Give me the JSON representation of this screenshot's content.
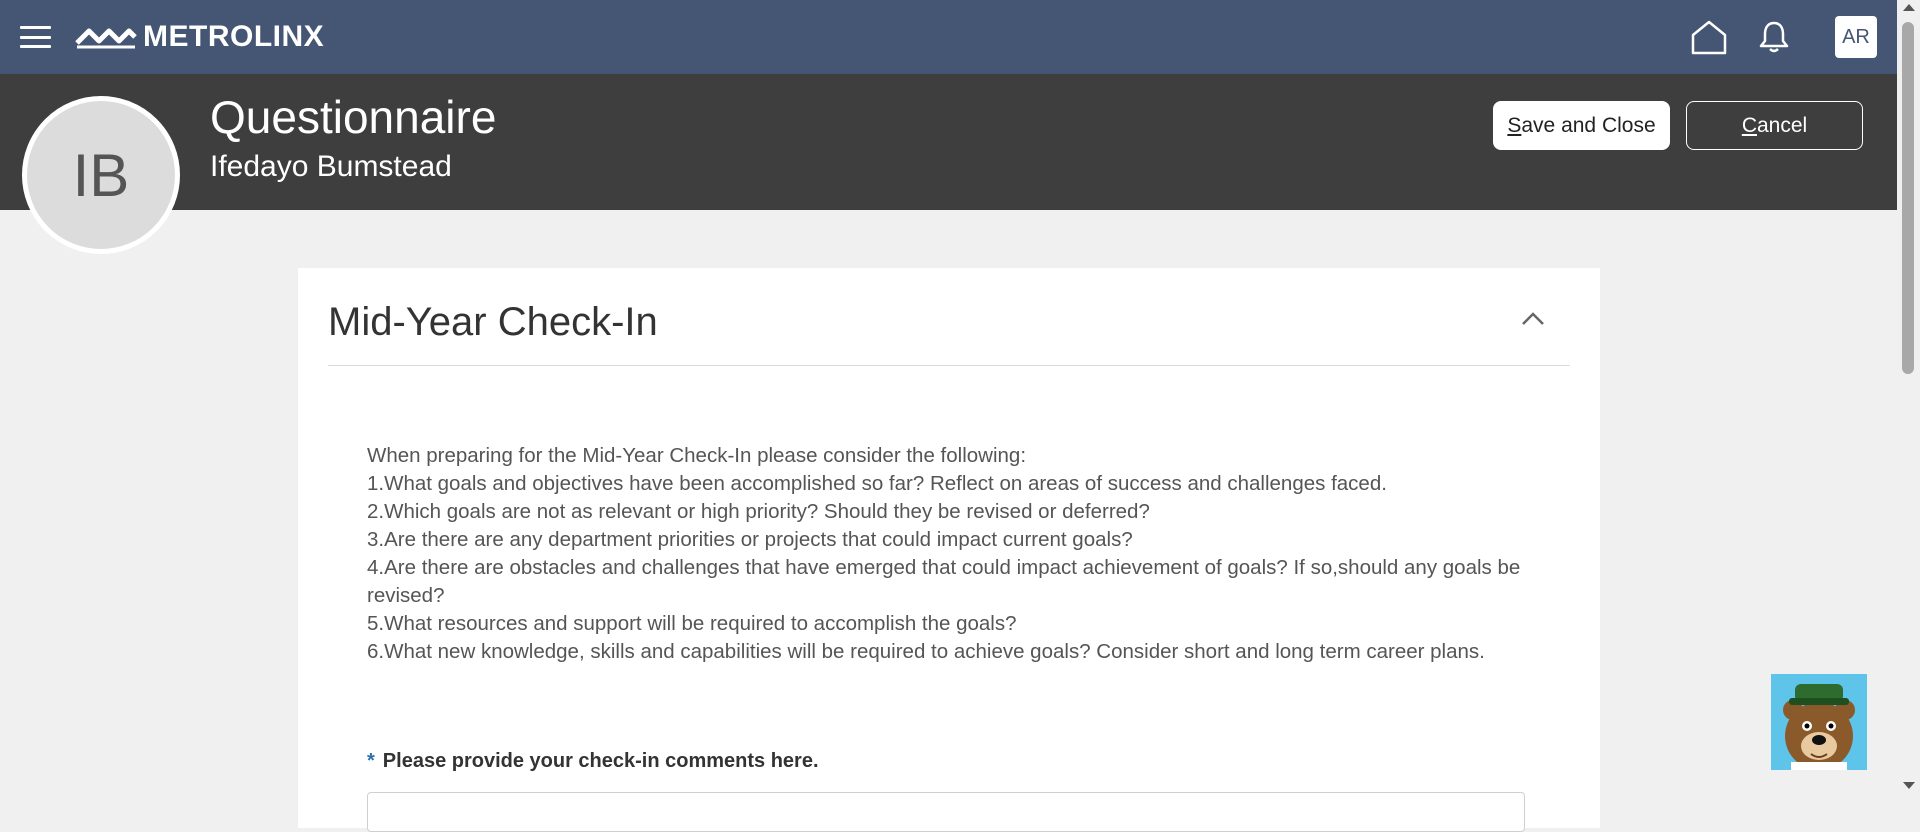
{
  "topbar": {
    "brand": "METROLINX",
    "user_initials": "AR",
    "bg_color": "#455675"
  },
  "header": {
    "title": "Questionnaire",
    "subtitle": "Ifedayo Bumstead",
    "profile_initials": "IB",
    "save_label_first": "S",
    "save_label_rest": "ave and Close",
    "cancel_label_first": "C",
    "cancel_label_rest": "ancel",
    "bg_color": "#3e3e3e"
  },
  "section": {
    "title": "Mid-Year Check-In",
    "instructions": [
      "When preparing for the Mid-Year Check-In please consider the following:",
      "1.What goals and objectives have been accomplished so far? Reflect on areas of success and challenges faced.",
      "2.Which goals are not as relevant or high priority? Should they be revised or deferred?",
      "3.Are there are any department priorities or projects that could impact current goals?",
      "4.Are there are obstacles and challenges that have emerged that could impact achievement of goals? If so,should any goals be revised?",
      "5.What resources and support will be required to accomplish the goals?",
      "6.What new knowledge, skills and capabilities will be required to achieve goals? Consider short and long term career plans."
    ],
    "required_marker": "*",
    "comment_label": "Please provide your check-in comments here."
  },
  "icons": {
    "menu": "hamburger-icon",
    "home": "home-icon",
    "notifications": "bell-icon",
    "collapse": "chevron-up-icon",
    "assistant": "bear-mascot-icon"
  }
}
